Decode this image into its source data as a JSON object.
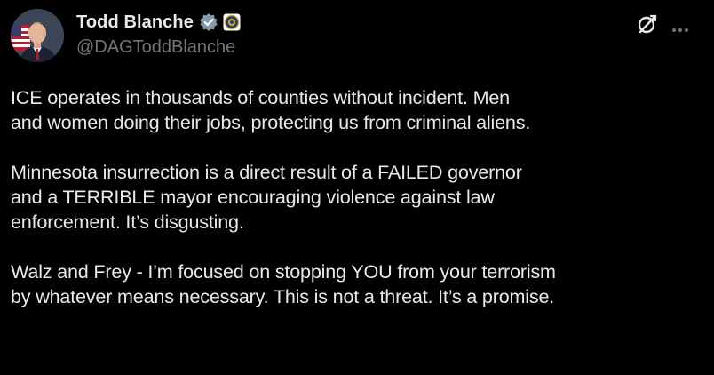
{
  "post": {
    "author": {
      "display_name": "Todd Blanche",
      "handle": "@DAGToddBlanche",
      "avatar_icon": "person-avatar",
      "verified_icon": "verified-badge-icon",
      "affiliation_icon": "doj-seal-icon"
    },
    "actions": {
      "grok_icon": "grok-icon",
      "more_icon": "more-options-icon"
    },
    "paragraphs": [
      "ICE operates in thousands of counties without incident. Men\nand women doing their jobs, protecting us from criminal aliens.",
      "Minnesota insurrection is a direct result of a FAILED governor\nand a TERRIBLE mayor encouraging violence against law\nenforcement. It’s disgusting.",
      "Walz and Frey - I’m focused on stopping YOU from your terrorism\nby whatever means necessary. This is not a threat. It’s a promise."
    ]
  },
  "colors": {
    "background": "#000000",
    "text_primary": "#e7e9ea",
    "text_secondary": "#71767b",
    "verified_badge": "#829aab"
  }
}
